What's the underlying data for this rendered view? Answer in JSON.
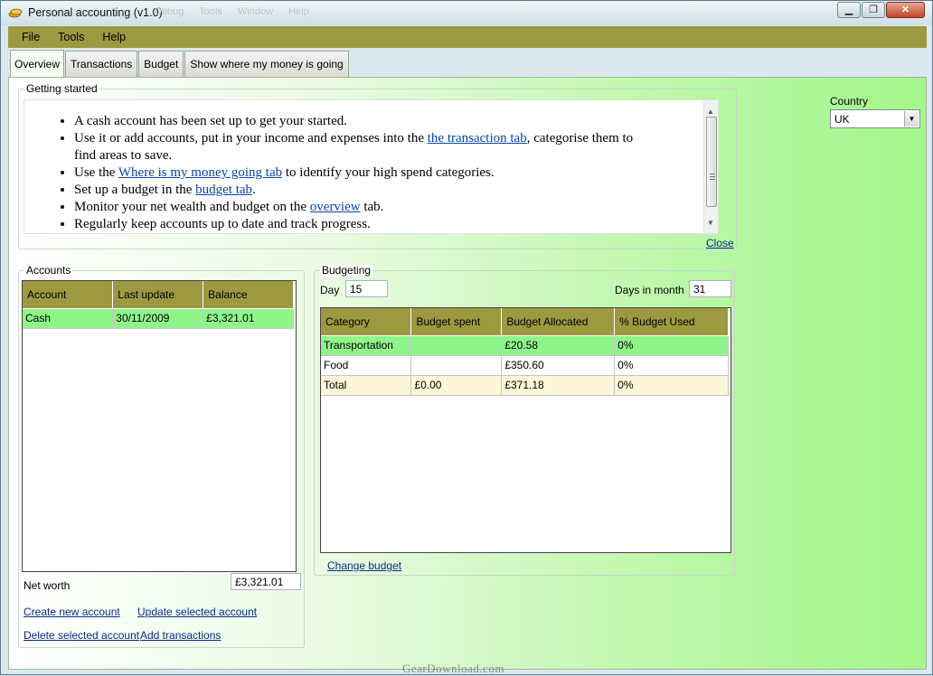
{
  "window": {
    "title": "Personal accounting (v1.0)",
    "ghost_menu": "Debug Tools Window Help",
    "controls": {
      "minimize": "▁",
      "maximize": "❐",
      "close": "✕"
    }
  },
  "menu": [
    "File",
    "Tools",
    "Help"
  ],
  "tabs": [
    "Overview",
    "Transactions",
    "Budget",
    "Show where my money is going"
  ],
  "getting_started": {
    "label": "Getting started",
    "items": [
      {
        "text": "A cash account has been set up to get your started."
      },
      {
        "pre": "Use it or add accounts, put in your income and expenses into the ",
        "link": "the transaction tab",
        "post": ", categorise them to find areas to save."
      },
      {
        "pre": "Use the ",
        "link": "Where is my money going tab",
        "post": " to identify your high spend categories."
      },
      {
        "pre": "Set up a budget in the ",
        "link": "budget tab",
        "post": "."
      },
      {
        "pre": "Monitor your net wealth and budget on the ",
        "link": "overview",
        "post": " tab."
      },
      {
        "text": "Regularly keep accounts up to date and track progress."
      }
    ],
    "close_label": "Close"
  },
  "country": {
    "label": "Country",
    "value": "UK"
  },
  "accounts": {
    "label": "Accounts",
    "columns": [
      "Account",
      "Last update",
      "Balance"
    ],
    "rows": [
      {
        "account": "Cash",
        "last_update": "30/11/2009",
        "balance": "£3,321.01"
      }
    ],
    "net_worth_label": "Net worth",
    "net_worth_value": "£3,321.01",
    "links": {
      "create": "Create new account",
      "update": "Update selected account",
      "delete": "Delete selected account",
      "add_tx": "Add transactions"
    }
  },
  "budgeting": {
    "label": "Budgeting",
    "day_label": "Day",
    "day_value": "15",
    "days_in_month_label": "Days in month",
    "days_in_month_value": "31",
    "columns": [
      "Category",
      "Budget spent",
      "Budget Allocated",
      "% Budget Used"
    ],
    "rows": [
      {
        "category": "Transportation",
        "spent": "",
        "allocated": "£20.58",
        "used": "0%"
      },
      {
        "category": "Food",
        "spent": "",
        "allocated": "£350.60",
        "used": "0%"
      },
      {
        "category": "Total",
        "spent": "£0.00",
        "allocated": "£371.18",
        "used": "0%"
      }
    ],
    "change_label": "Change budget"
  },
  "watermark": "GearDownload.com",
  "colors": {
    "menubar": "#9c9940",
    "selected_row": "#8ff58a",
    "total_row": "#fbf7d8"
  }
}
